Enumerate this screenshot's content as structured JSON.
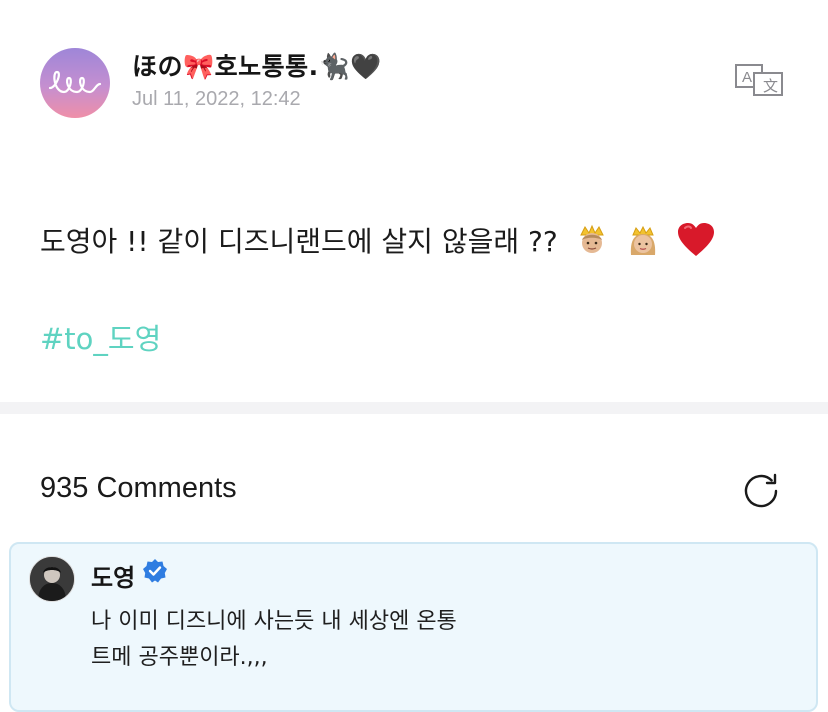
{
  "post": {
    "author": "ほの🎀호노통통.🐈‍⬛🖤",
    "date": "Jul 11, 2022, 12:42",
    "body_text": "도영아 !! 같이 디즈니랜드에 살지 않을래 ??",
    "body_emojis": [
      "👸🏼-prince-crown-emoji",
      "👸-princess-crown-emoji",
      "❤️-heart-emoji"
    ],
    "hashtag": "#to_도영",
    "avatar_icon": "script-signature-icon",
    "translate_icon": "translate-icon"
  },
  "comments": {
    "title": "935 Comments",
    "refresh_icon": "refresh-icon",
    "items": [
      {
        "name": "도영",
        "verified": true,
        "line1": "나 이미 디즈니에 사는듯 내 세상엔 온통",
        "line2": "트메 공주뿐이라.,,,"
      }
    ]
  },
  "colors": {
    "hashtag": "#5fd3c1",
    "date": "#a9a9ae",
    "verified": "#2f7de1",
    "comment_bg": "#eef8fd",
    "comment_border": "#cfe7f3"
  }
}
